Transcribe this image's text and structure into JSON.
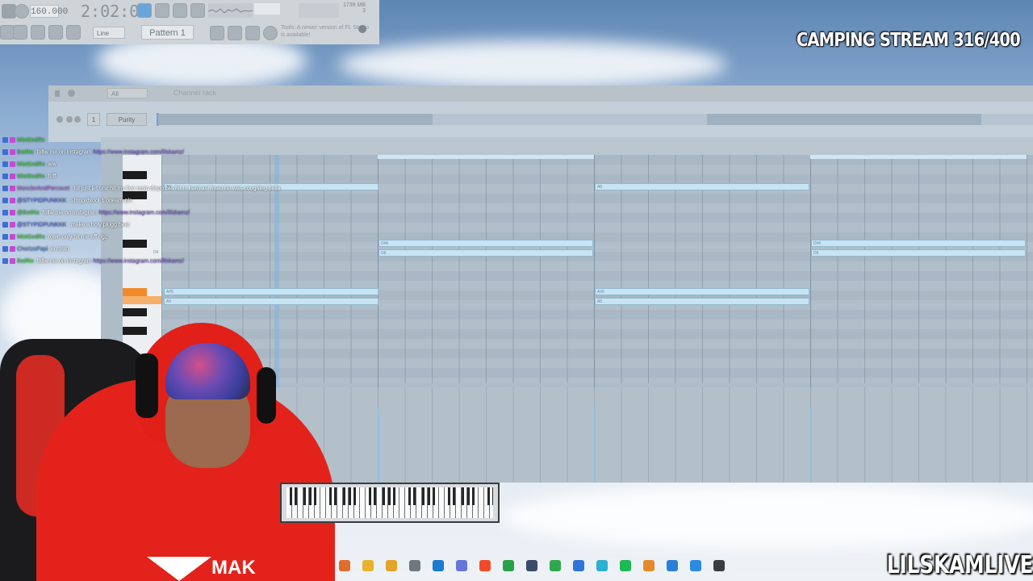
{
  "overlay": {
    "stream_title": "CAMPING STREAM 316/400",
    "watermark": "LILSKAMLIVE"
  },
  "toolbar": {
    "bpm": "160.000",
    "time": "2:02:00",
    "memory": "1739 MB",
    "cpu_voices": "3",
    "snap": "Line",
    "pattern": "Pattern 1",
    "update_notice": "Tools: A newer version of FL Studio is available!"
  },
  "channel_rack": {
    "title": "Channel rack",
    "filter": "All",
    "channel_number": "1",
    "channel_name": "Purity"
  },
  "piano_roll": {
    "notes": [
      {
        "label": "A5",
        "bar": 0,
        "row": "A5"
      },
      {
        "label": "D#6",
        "bar": 1,
        "row": "D#6"
      },
      {
        "label": "D6",
        "bar": 1,
        "row": "D6"
      },
      {
        "label": "A5",
        "bar": 2,
        "row": "A5"
      },
      {
        "label": "D#6",
        "bar": 3,
        "row": "D#6"
      },
      {
        "label": "D6",
        "bar": 3,
        "row": "D6"
      },
      {
        "label": "A#5",
        "bar": 0,
        "row": "A#5"
      },
      {
        "label": "A5",
        "bar": 0,
        "row": "A5b"
      },
      {
        "label": "A#5",
        "bar": 2,
        "row": "A#5"
      },
      {
        "label": "A5",
        "bar": 2,
        "row": "A5b"
      }
    ],
    "key_label": "D6"
  },
  "chat": [
    {
      "user": "MistGodRx",
      "color": "#3fd43f",
      "msg": ""
    },
    {
      "user": "BotRix",
      "color": "#3fd43f",
      "msg": ": follw me on instagram ",
      "link": "https://www.instagram.com/lilskamz/"
    },
    {
      "user": "MistGodRx",
      "color": "#3fd43f",
      "msg": ": ww"
    },
    {
      "user": "MistGodRx",
      "color": "#3fd43f",
      "msg": ": tuff"
    },
    {
      "user": "MonclerAndPercocet",
      "color": "#b46ad6",
      "msg": " : lol just let unc hit my live rosin dispo bro hit ts hard as! lmao he was coughing hella"
    },
    {
      "user": "@STYPIDPUNKKK",
      "color": "#5b74e0",
      "msg": " : stoopidxool 1 oneam pls"
    },
    {
      "user": "@BotRix",
      "color": "#3fd43f",
      "msg": ": follw me on instagram ",
      "link": "https://www.instagram.com/lilskamz/"
    },
    {
      "user": "@STYPIDPUNKKK",
      "color": "#5b74e0",
      "msg": " : make a holy plugg beat"
    },
    {
      "user": "MistGodRx",
      "color": "#3fd43f",
      "msg": ": rosin only hit me off rigz"
    },
    {
      "user": "ChorizoPapi",
      "color": "#4f8ee8",
      "msg": ": w rosin"
    },
    {
      "user": "BotRix",
      "color": "#3fd43f",
      "msg": ": follw me on instagram ",
      "link": "https://www.instagram.com/lilskamz/"
    }
  ],
  "streamer": {
    "hoodie_text": "MAK"
  },
  "taskbar": {
    "icons": [
      "app-icon",
      "chrome-icon",
      "folder-icon",
      "app-icon",
      "photoshop-icon",
      "discord-icon",
      "brave-icon",
      "chrome-alt-icon",
      "steam-icon",
      "app-icon",
      "app-icon",
      "app-icon",
      "spotify-icon",
      "fl-studio-icon",
      "app-icon",
      "notepad-icon",
      "media-icon"
    ]
  }
}
